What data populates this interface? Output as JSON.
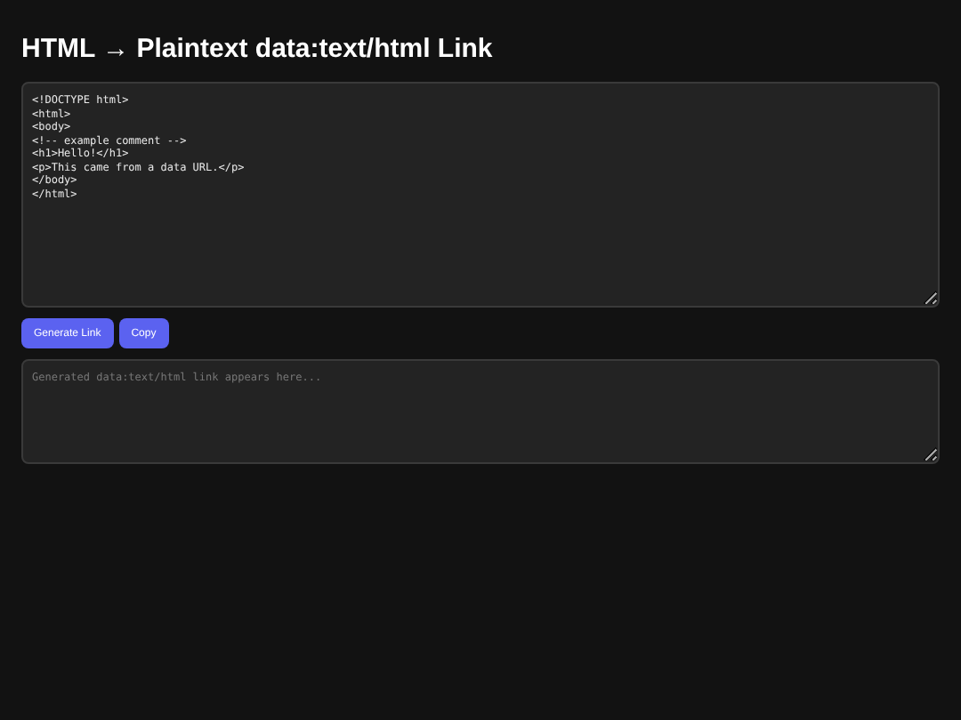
{
  "title": "HTML → Plaintext data:text/html Link",
  "editor": {
    "value": "<!DOCTYPE html>\n<html>\n<body>\n<!-- example comment -->\n<h1>Hello!</h1>\n<p>This came from a data URL.</p>\n</body>\n</html>"
  },
  "buttons": [
    "Generate Link",
    "Copy"
  ],
  "output": {
    "placeholder": "Generated data:text/html link appears here..."
  }
}
